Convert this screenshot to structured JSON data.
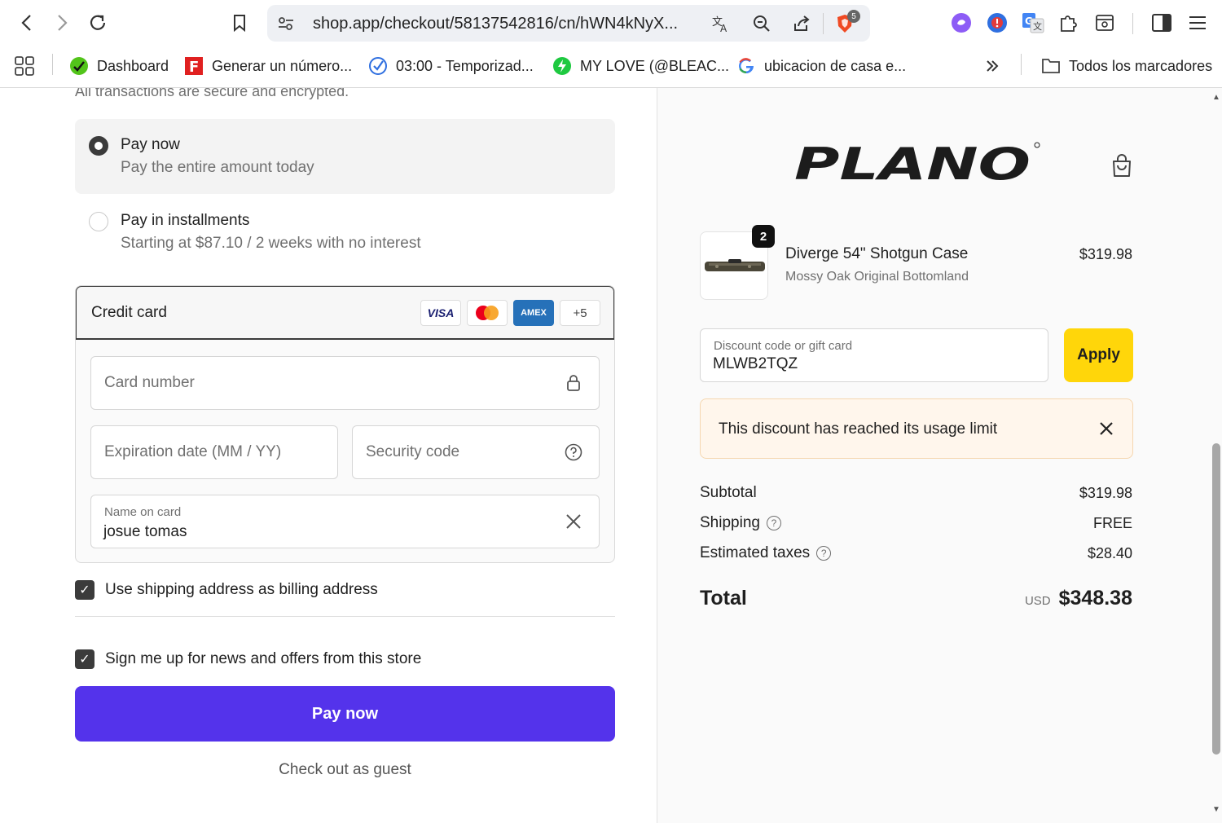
{
  "browser": {
    "url": "shop.app/checkout/58137542816/cn/hWN4kNyX...",
    "shield_badge": "5",
    "bookmarks": [
      {
        "label": "Dashboard"
      },
      {
        "label": "Generar un número..."
      },
      {
        "label": "03:00 - Temporizad..."
      },
      {
        "label": "MY LOVE (@BLEAC..."
      },
      {
        "label": "ubicacion de casa e..."
      }
    ],
    "overflow_icon": "chevron-double-right-icon",
    "all_bookmarks": "Todos los marcadores"
  },
  "payment": {
    "secure_note": "All transactions are secure and encrypted.",
    "options": [
      {
        "title": "Pay now",
        "subtitle": "Pay the entire amount today",
        "selected": true
      },
      {
        "title": "Pay in installments",
        "subtitle": "Starting at $87.10 / 2 weeks with no interest",
        "selected": false
      }
    ],
    "card": {
      "title": "Credit card",
      "brands": [
        "VISA",
        "AMEX"
      ],
      "more_brands": "+5",
      "number_placeholder": "Card number",
      "expiry_placeholder": "Expiration date (MM / YY)",
      "cvc_placeholder": "Security code",
      "name_label": "Name on card",
      "name_value": "josue tomas"
    },
    "billing_checkbox": "Use shipping address as billing address",
    "newsletter_checkbox": "Sign me up for news and offers from this store",
    "pay_button": "Pay now",
    "guest_link": "Check out as guest"
  },
  "summary": {
    "brand": "PLANO",
    "item": {
      "quantity": "2",
      "name": "Diverge 54\" Shotgun Case",
      "variant": "Mossy Oak Original Bottomland",
      "price": "$319.98"
    },
    "discount_label": "Discount code or gift card",
    "discount_value": "MLWB2TQZ",
    "apply_button": "Apply",
    "alert": "This discount has reached its usage limit",
    "subtotal_label": "Subtotal",
    "subtotal_value": "$319.98",
    "shipping_label": "Shipping",
    "shipping_value": "FREE",
    "taxes_label": "Estimated taxes",
    "taxes_value": "$28.40",
    "total_label": "Total",
    "currency": "USD",
    "total_value": "$348.38"
  },
  "colors": {
    "primary": "#5433eb",
    "apply": "#ffd60a",
    "alert_bg": "#fff6ec"
  }
}
